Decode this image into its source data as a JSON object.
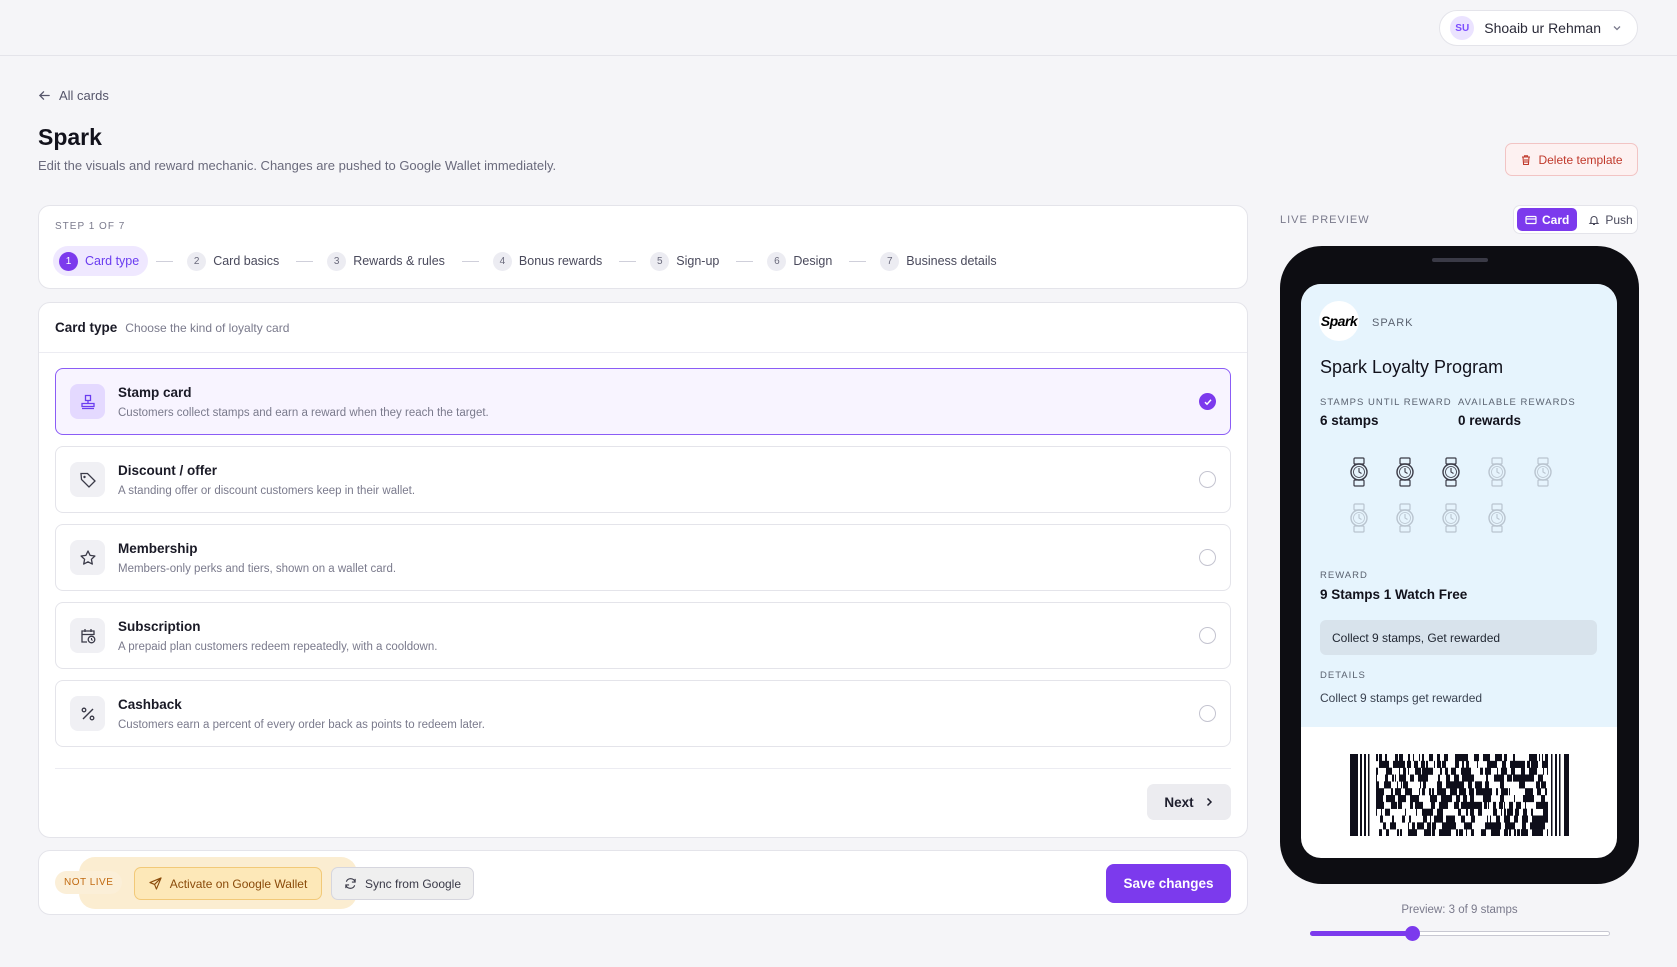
{
  "header": {
    "user_initials": "SU",
    "user_name": "Shoaib ur Rehman"
  },
  "page": {
    "back_label": "All cards",
    "title": "Spark",
    "subtitle": "Edit the visuals and reward mechanic. Changes are pushed to Google Wallet immediately.",
    "delete_label": "Delete template"
  },
  "stepper": {
    "label": "STEP 1 OF 7",
    "steps": [
      {
        "num": "1",
        "label": "Card type"
      },
      {
        "num": "2",
        "label": "Card basics"
      },
      {
        "num": "3",
        "label": "Rewards & rules"
      },
      {
        "num": "4",
        "label": "Bonus rewards"
      },
      {
        "num": "5",
        "label": "Sign-up"
      },
      {
        "num": "6",
        "label": "Design"
      },
      {
        "num": "7",
        "label": "Business details"
      }
    ]
  },
  "card_type": {
    "title": "Card type",
    "hint": "Choose the kind of loyalty card",
    "options": [
      {
        "title": "Stamp card",
        "desc": "Customers collect stamps and earn a reward when they reach the target.",
        "icon": "stamp-icon",
        "selected": true
      },
      {
        "title": "Discount / offer",
        "desc": "A standing offer or discount customers keep in their wallet.",
        "icon": "tag-icon",
        "selected": false
      },
      {
        "title": "Membership",
        "desc": "Members-only perks and tiers, shown on a wallet card.",
        "icon": "star-icon",
        "selected": false
      },
      {
        "title": "Subscription",
        "desc": "A prepaid plan customers redeem repeatedly, with a cooldown.",
        "icon": "calendar-clock-icon",
        "selected": false
      },
      {
        "title": "Cashback",
        "desc": "Customers earn a percent of every order back as points to redeem later.",
        "icon": "percent-icon",
        "selected": false
      }
    ],
    "next_label": "Next"
  },
  "actions": {
    "status": "NOT LIVE",
    "activate_label": "Activate on Google Wallet",
    "sync_label": "Sync from Google",
    "save_label": "Save changes"
  },
  "preview": {
    "label": "LIVE PREVIEW",
    "toggle_card": "Card",
    "toggle_push": "Push",
    "logo_text": "Spark",
    "brand": "SPARK",
    "program": "Spark Loyalty Program",
    "stat1_label": "STAMPS UNTIL REWARD",
    "stat1_value": "6 stamps",
    "stat2_label": "AVAILABLE REWARDS",
    "stat2_value": "0 rewards",
    "stamps_total": 9,
    "stamps_filled": 3,
    "reward_label": "REWARD",
    "reward_value": "9 Stamps 1 Watch Free",
    "reward_box": "Collect 9 stamps, Get rewarded",
    "details_label": "DETAILS",
    "details_value": "Collect 9 stamps get rewarded",
    "preview_caption": "Preview: 3 of 9 stamps",
    "slider_fraction": 0.34
  },
  "colors": {
    "accent": "#7c3aed",
    "card_bg": "#e6f4fd",
    "warning": "#fde8b8",
    "danger": "#c0392b"
  }
}
